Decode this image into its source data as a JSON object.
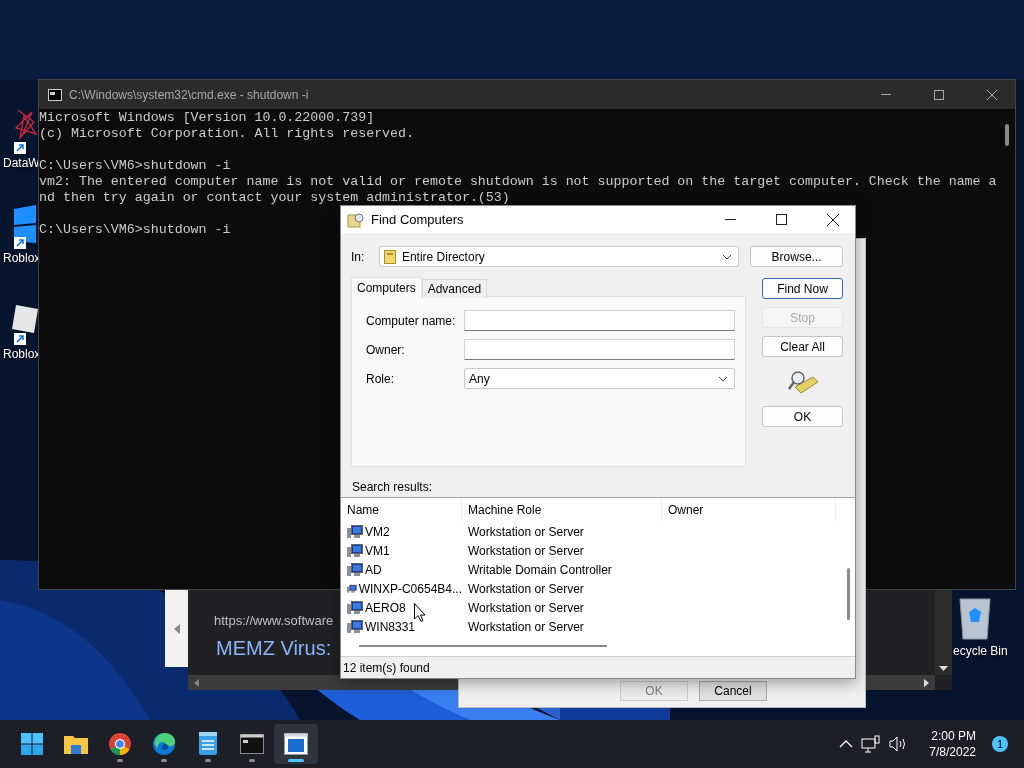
{
  "desktop_icons": [
    {
      "label": "DataW",
      "kind": "scribble"
    },
    {
      "label": "Roblox",
      "kind": "blue"
    },
    {
      "label": "Roblox",
      "kind": "grey"
    }
  ],
  "recycle_bin": {
    "label": "ecycle Bin"
  },
  "browser_window": {
    "url": "https://www.software",
    "heading": "MEMZ Virus: "
  },
  "shutdown_dialog": {
    "buttons": [
      {
        "label": "OK",
        "disabled": true
      },
      {
        "label": "Cancel",
        "disabled": false
      }
    ]
  },
  "cmd_window": {
    "title": "C:\\Windows\\system32\\cmd.exe - shutdown -i",
    "blocks": [
      [
        "Microsoft Windows [Version 10.0.22000.739]",
        "(c) Microsoft Corporation. All rights reserved."
      ],
      [
        "C:\\Users\\VM6>shutdown -i",
        "vm2: The entered computer name is not valid or remote shutdown is not supported on the target computer. Check the name a",
        "nd then try again or contact your system administrator.(53)"
      ],
      [
        "C:\\Users\\VM6>shutdown -i"
      ]
    ]
  },
  "find_dialog": {
    "title": "Find Computers",
    "in_label": "In:",
    "in_value": "Entire Directory",
    "browse": "Browse...",
    "tabs": [
      {
        "label": "Computers",
        "selected": true
      },
      {
        "label": "Advanced",
        "selected": false
      }
    ],
    "fields": [
      {
        "label": "Computer name:",
        "kind": "text"
      },
      {
        "label": "Owner:",
        "kind": "text"
      },
      {
        "label": "Role:",
        "kind": "combo",
        "value": "Any"
      }
    ],
    "buttons": [
      {
        "label": "Find Now",
        "default": true,
        "disabled": false
      },
      {
        "label": "Stop",
        "default": false,
        "disabled": true
      },
      {
        "label": "Clear All",
        "default": false,
        "disabled": false
      }
    ],
    "ok": "OK",
    "results_label": "Search results:",
    "columns": [
      "Name",
      "Machine Role",
      "Owner"
    ],
    "rows": [
      {
        "name": "VM2",
        "role": "Workstation or Server"
      },
      {
        "name": "VM1",
        "role": "Workstation or Server"
      },
      {
        "name": "AD",
        "role": "Writable Domain Controller"
      },
      {
        "name": "WINXP-C0654B4...",
        "role": "Workstation or Server"
      },
      {
        "name": "AERO8",
        "role": "Workstation or Server"
      },
      {
        "name": "WIN8331",
        "role": "Workstation or Server"
      }
    ],
    "status": "12 item(s) found"
  },
  "taskbar": {
    "apps": [
      {
        "kind": "start",
        "running": false,
        "selected": false
      },
      {
        "kind": "folder",
        "running": false,
        "selected": false
      },
      {
        "kind": "chrome",
        "running": true,
        "selected": false
      },
      {
        "kind": "edge",
        "running": true,
        "selected": false
      },
      {
        "kind": "notepad",
        "running": true,
        "selected": false
      },
      {
        "kind": "terminal",
        "running": true,
        "selected": false
      },
      {
        "kind": "window",
        "running": true,
        "selected": true
      }
    ]
  },
  "tray": {
    "time": "2:00 PM",
    "date": "7/8/2022",
    "badge": "1"
  }
}
